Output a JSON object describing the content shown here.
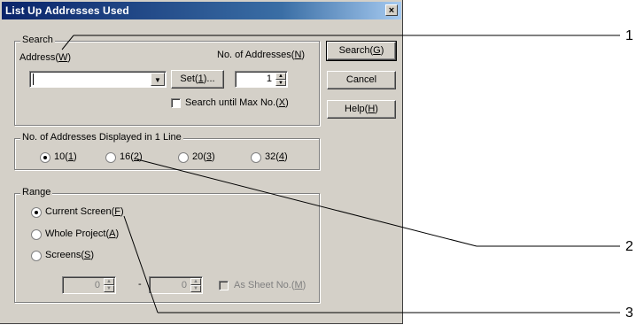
{
  "dialog": {
    "title": "List Up Addresses Used",
    "close_glyph": "×"
  },
  "search": {
    "legend": "Search",
    "address_label": "Address(",
    "address_key": "W",
    "address_value": "",
    "dropdown_glyph": "▼",
    "set_label": "Set(",
    "set_key": "1",
    "set_suffix": ")...",
    "count_label": "No. of Addresses(",
    "count_key": "N",
    "count_value": "1",
    "until_max_label": "Search until Max No.(",
    "until_max_key": "X",
    "until_max_checked": false
  },
  "buttons": {
    "search_label": "Search(",
    "search_key": "G",
    "cancel_label": "Cancel",
    "help_label": "Help(",
    "help_key": "H"
  },
  "per_line": {
    "legend": "No. of Addresses Displayed in 1 Line",
    "options": [
      {
        "label": "10(",
        "key": "1",
        "selected": true
      },
      {
        "label": "16(",
        "key": "2",
        "selected": false
      },
      {
        "label": "20(",
        "key": "3",
        "selected": false
      },
      {
        "label": "32(",
        "key": "4",
        "selected": false
      }
    ]
  },
  "range": {
    "legend": "Range",
    "options": [
      {
        "label": "Current Screen(",
        "key": "F",
        "selected": true
      },
      {
        "label": "Whole Project(",
        "key": "A",
        "selected": false
      },
      {
        "label": "Screens(",
        "key": "S",
        "selected": false
      }
    ],
    "from_value": "0",
    "to_value": "0",
    "dash": "-",
    "sheet_label": "As Sheet No.(",
    "sheet_key": "M"
  },
  "callouts": [
    "1",
    "2",
    "3"
  ],
  "close_paren": ")"
}
